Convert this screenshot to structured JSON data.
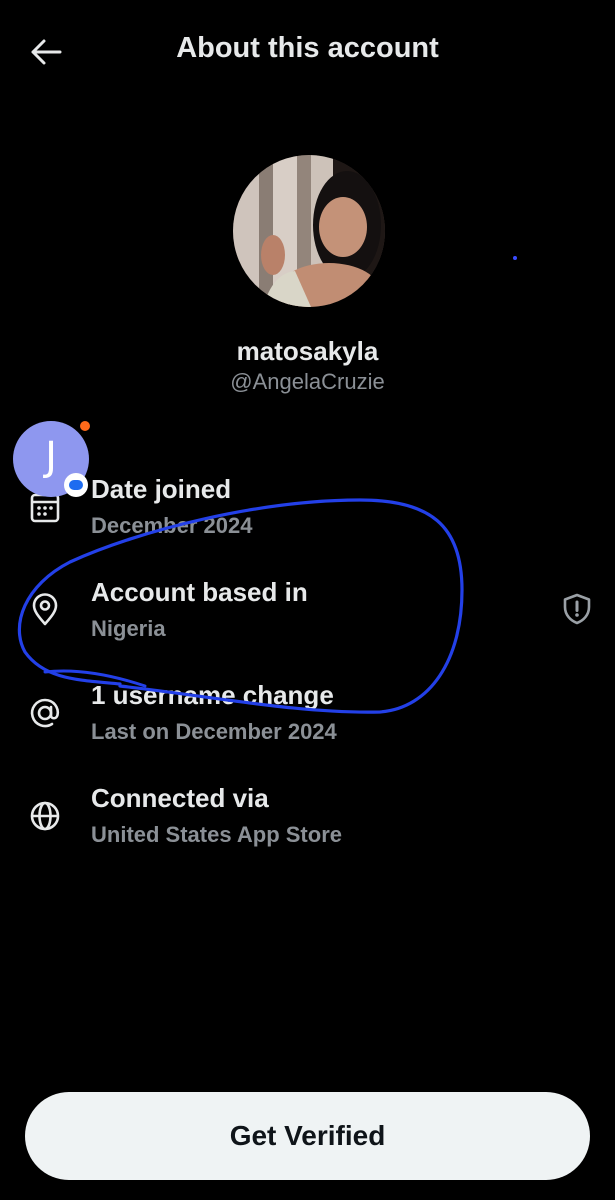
{
  "header": {
    "title": "About this account",
    "back_icon": "arrow-left-icon"
  },
  "profile": {
    "display_name": "matosakyla",
    "handle": "@AngelaCruzie"
  },
  "details": [
    {
      "icon": "calendar-icon",
      "title": "Date joined",
      "subtitle": "December 2024"
    },
    {
      "icon": "location-pin-icon",
      "title": "Account based in",
      "subtitle": "Nigeria"
    },
    {
      "icon": "at-sign-icon",
      "title": "1 username change",
      "subtitle": "Last on December 2024"
    },
    {
      "icon": "globe-icon",
      "title": "Connected via",
      "subtitle": "United States App Store"
    }
  ],
  "chat_head": {
    "initial": "J",
    "color": "#8e97ef",
    "notification_dot_color": "#ff6a1a"
  },
  "shield_icon": "shield-exclamation-icon",
  "annotation_color": "#2340e8",
  "cta": {
    "label": "Get Verified"
  },
  "colors": {
    "background": "#000000",
    "primary_text": "#e7e9ea",
    "secondary_text": "#8b9096",
    "button_bg": "#eff3f4",
    "button_text": "#0f1419"
  }
}
